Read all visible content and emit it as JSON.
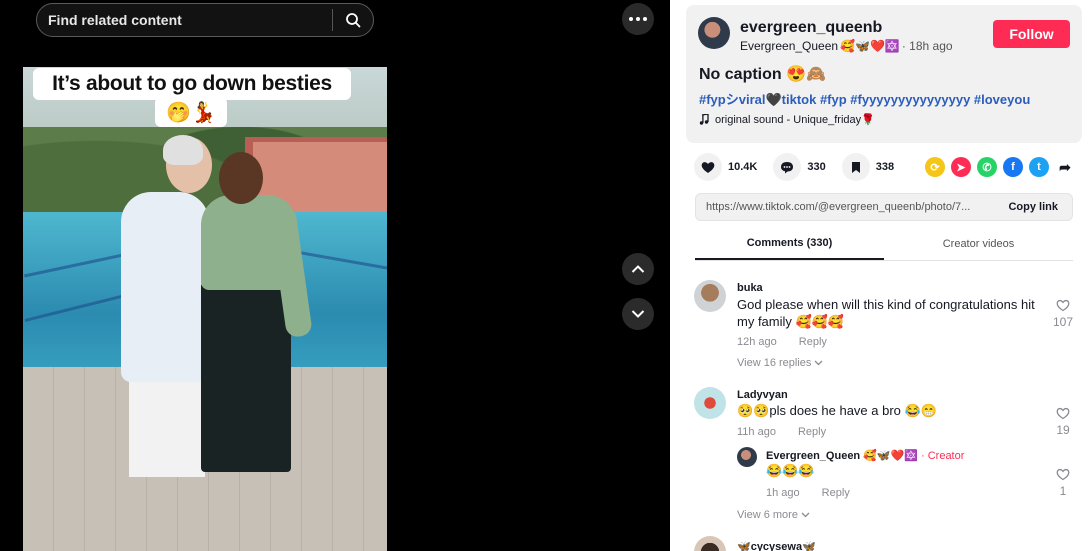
{
  "search": {
    "placeholder": "Find related content"
  },
  "post": {
    "image_caption_line1": "It’s about to go down besties",
    "image_caption_line2": "🤭💃"
  },
  "author": {
    "username": "evergreen_queenb",
    "display_name": "Evergreen_Queen",
    "display_emojis": "🥰🦋❤️🔯",
    "time": "· 18h ago",
    "follow_label": "Follow",
    "caption": "No caption 😍🙈",
    "hashtags": "#fypシviral🖤tiktok #fyp #fyyyyyyyyyyyyyyy #loveyou",
    "sound": "original sound - Unique_friday🌹"
  },
  "stats": {
    "likes": "10.4K",
    "comments": "330",
    "saves": "338"
  },
  "share_icons": [
    {
      "name": "repost",
      "color": "#f5c518"
    },
    {
      "name": "send",
      "color": "#fe2c55"
    },
    {
      "name": "whatsapp",
      "color": "#25d366"
    },
    {
      "name": "facebook",
      "color": "#1877f2"
    },
    {
      "name": "twitter",
      "color": "#1da1f2"
    }
  ],
  "link": {
    "url": "https://www.tiktok.com/@evergreen_queenb/photo/7...",
    "copy_label": "Copy link"
  },
  "tabs": {
    "comments": "Comments (330)",
    "creator_videos": "Creator videos"
  },
  "comments": [
    {
      "user": "buka",
      "text": "God please when will this kind of congratulations hit my family 🥰🥰🥰",
      "time": "12h ago",
      "reply": "Reply",
      "likes": "107",
      "replies_label": "View 16 replies"
    },
    {
      "user": "Ladyvyan",
      "text": "🥺🥺pls does he have a bro 😂😁",
      "time": "11h ago",
      "reply": "Reply",
      "likes": "19",
      "reply_item": {
        "user": "Evergreen_Queen 🥰🦋❤️🔯",
        "creator_label": "· Creator",
        "text": "😂😂😂",
        "time": "1h ago",
        "reply": "Reply",
        "likes": "1"
      },
      "replies_label": "View 6 more"
    },
    {
      "user": "🦋cycysewa🦋"
    }
  ]
}
